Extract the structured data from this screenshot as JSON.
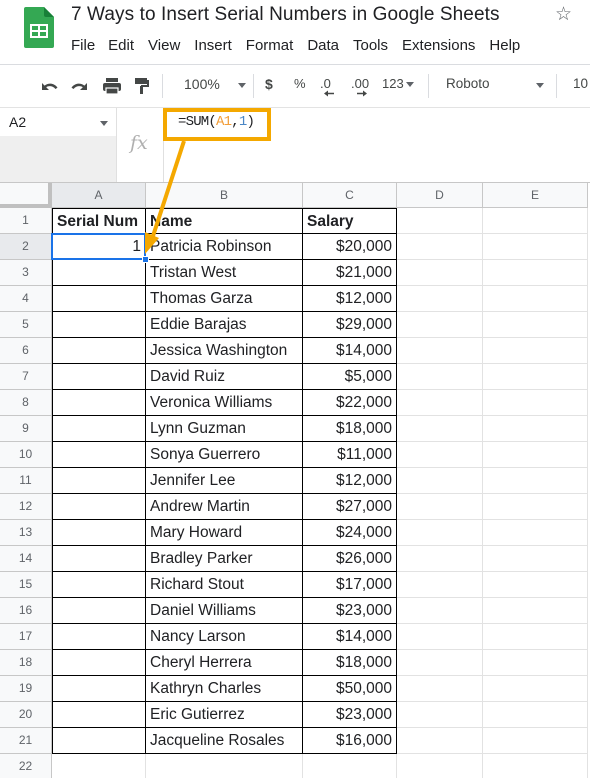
{
  "app": {
    "title": "7 Ways to Insert Serial Numbers in Google Sheets",
    "logo_icon": "google-sheets-logo",
    "star_icon": "star-outline-icon",
    "star_glyph": "☆",
    "brand_color": "#34a853"
  },
  "menu": [
    "File",
    "Edit",
    "View",
    "Insert",
    "Format",
    "Data",
    "Tools",
    "Extensions",
    "Help"
  ],
  "toolbar": {
    "undo_icon": "undo-icon",
    "redo_icon": "redo-icon",
    "print_icon": "print-icon",
    "paint_format_icon": "paint-format-icon",
    "zoom": "100%",
    "currency": "$",
    "percent": "%",
    "decrease_decimal": ".0",
    "increase_decimal": ".00",
    "more_formats": "123",
    "font": "Roboto",
    "font_size": "10"
  },
  "formula_bar": {
    "name_box": "A2",
    "fx_label": "fx",
    "formula_prefix": "=SUM(",
    "formula_ref": "A1",
    "formula_comma": ",",
    "formula_num": "1",
    "formula_suffix": ")"
  },
  "annotation": {
    "highlight_color": "#f4a800",
    "description": "Arrow from formula to cell A2"
  },
  "grid": {
    "columns": [
      "A",
      "B",
      "C",
      "D",
      "E"
    ],
    "selected_column": "A",
    "selected_cell": "A2",
    "row_numbers": [
      "1",
      "2",
      "3",
      "4",
      "5",
      "6",
      "7",
      "8",
      "9",
      "10",
      "11",
      "12",
      "13",
      "14",
      "15",
      "16",
      "17",
      "18",
      "19",
      "20",
      "21",
      "22"
    ],
    "headers": {
      "a": "Serial Num",
      "b": "Name",
      "c": "Salary"
    },
    "a2_value": "1",
    "rows": [
      {
        "name": "Patricia Robinson",
        "salary": "$20,000"
      },
      {
        "name": "Tristan West",
        "salary": "$21,000"
      },
      {
        "name": "Thomas Garza",
        "salary": "$12,000"
      },
      {
        "name": "Eddie Barajas",
        "salary": "$29,000"
      },
      {
        "name": "Jessica Washington",
        "salary": "$14,000"
      },
      {
        "name": "David Ruiz",
        "salary": "$5,000"
      },
      {
        "name": "Veronica Williams",
        "salary": "$22,000"
      },
      {
        "name": "Lynn Guzman",
        "salary": "$18,000"
      },
      {
        "name": "Sonya Guerrero",
        "salary": "$11,000"
      },
      {
        "name": "Jennifer Lee",
        "salary": "$12,000"
      },
      {
        "name": "Andrew Martin",
        "salary": "$27,000"
      },
      {
        "name": "Mary Howard",
        "salary": "$24,000"
      },
      {
        "name": "Bradley Parker",
        "salary": "$26,000"
      },
      {
        "name": "Richard Stout",
        "salary": "$17,000"
      },
      {
        "name": "Daniel Williams",
        "salary": "$23,000"
      },
      {
        "name": "Nancy Larson",
        "salary": "$14,000"
      },
      {
        "name": "Cheryl Herrera",
        "salary": "$18,000"
      },
      {
        "name": "Kathryn Charles",
        "salary": "$50,000"
      },
      {
        "name": "Eric Gutierrez",
        "salary": "$23,000"
      },
      {
        "name": "Jacqueline Rosales",
        "salary": "$16,000"
      }
    ]
  }
}
